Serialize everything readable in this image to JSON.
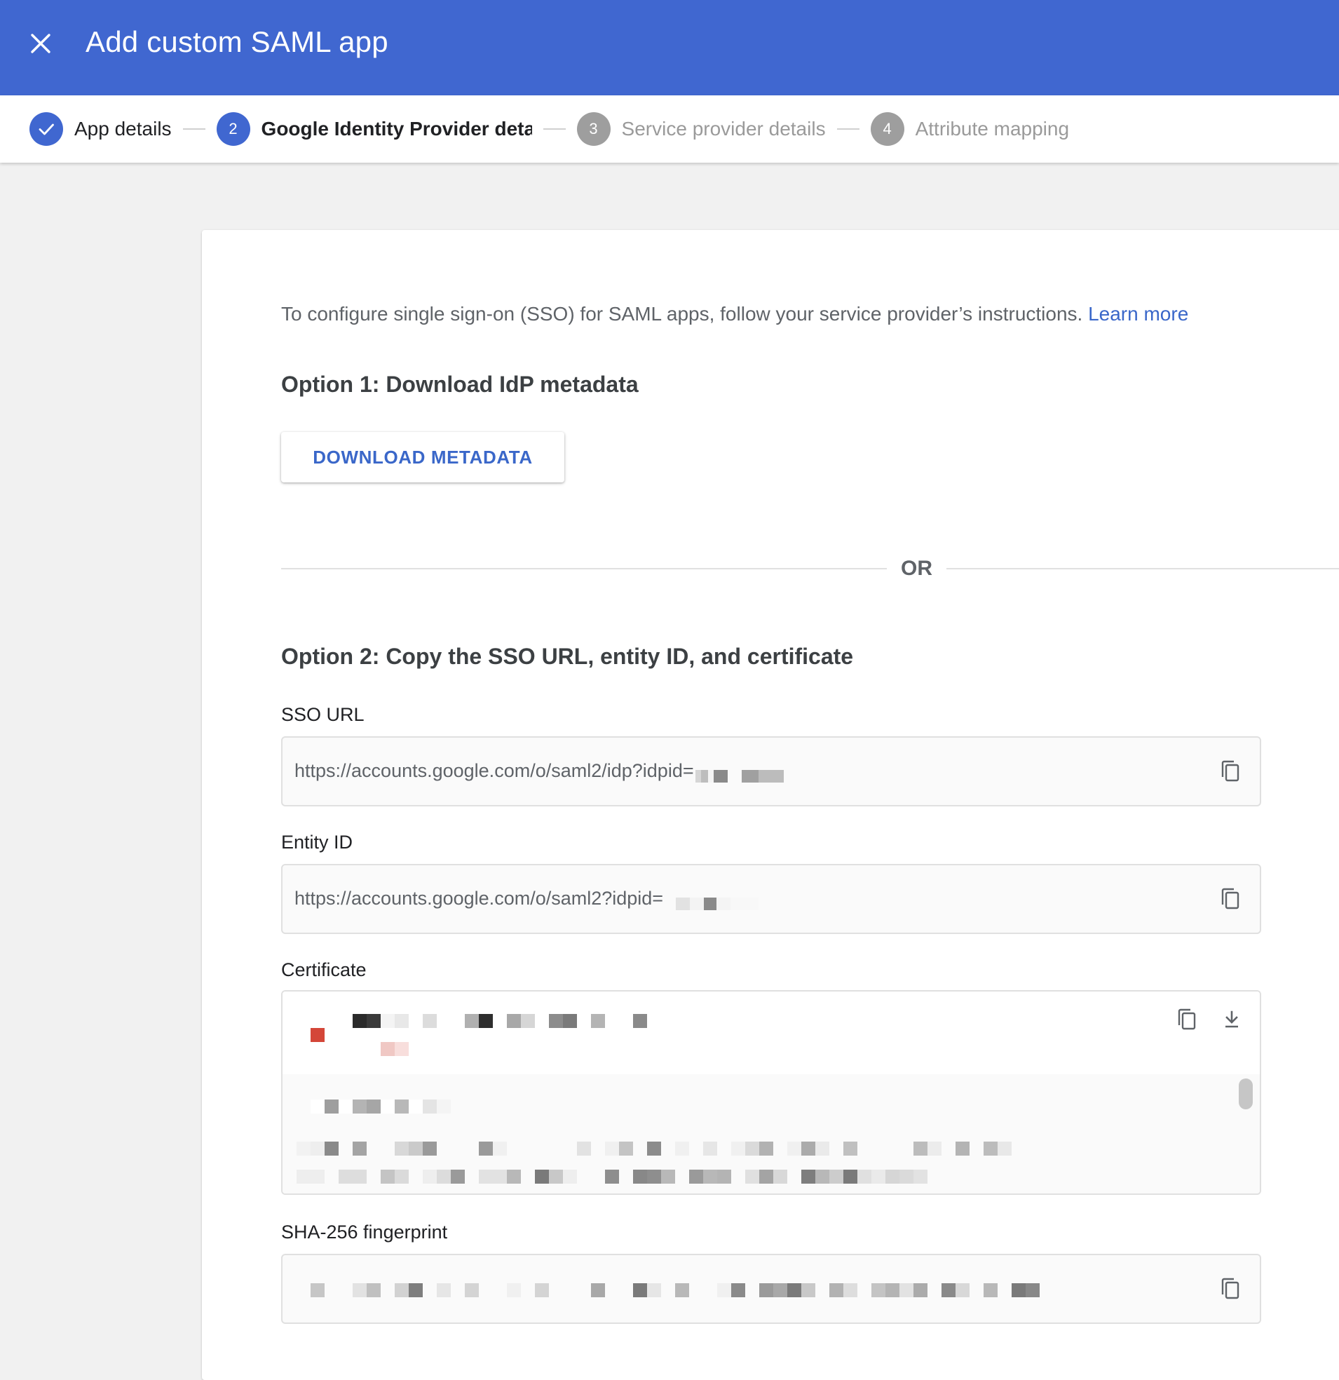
{
  "header": {
    "title": "Add custom SAML app",
    "close_icon": "close-icon"
  },
  "stepper": {
    "steps": [
      {
        "number": "1",
        "label": "App details",
        "state": "done"
      },
      {
        "number": "2",
        "label": "Google Identity Provider details",
        "state": "active"
      },
      {
        "number": "3",
        "label": "Service provider details",
        "state": "todo"
      },
      {
        "number": "4",
        "label": "Attribute mapping",
        "state": "todo"
      }
    ]
  },
  "main": {
    "intro_text": "To configure single sign-on (SSO) for SAML apps, follow your service provider’s instructions.",
    "learn_more": "Learn more",
    "option1_heading": "Option 1: Download IdP metadata",
    "download_button": "DOWNLOAD METADATA",
    "or_text": "OR",
    "option2_heading": "Option 2: Copy the SSO URL, entity ID, and certificate",
    "sso_url": {
      "label": "SSO URL",
      "value": "https://accounts.google.com/o/saml2/idp?idpid="
    },
    "entity_id": {
      "label": "Entity ID",
      "value": "https://accounts.google.com/o/saml2?idpid="
    },
    "certificate": {
      "label": "Certificate"
    },
    "fingerprint": {
      "label": "SHA-256 fingerprint"
    }
  },
  "colors": {
    "brand_blue": "#4067d0",
    "link_blue": "#3a67c9",
    "inactive_step": "#9e9e9e",
    "redaction_red": "#d44638"
  },
  "icons": [
    "close-icon",
    "check-icon",
    "copy-icon",
    "download-icon"
  ]
}
